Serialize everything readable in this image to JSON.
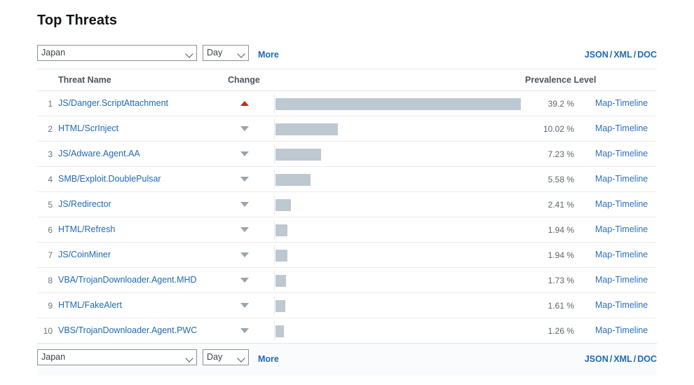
{
  "page": {
    "title": "Top Threats"
  },
  "controls": {
    "country_value": "Japan",
    "period_value": "Day",
    "more_label": "More",
    "export": {
      "json_label": "JSON",
      "xml_label": "XML",
      "doc_label": "DOC",
      "separator": "/"
    }
  },
  "table": {
    "headers": {
      "threat_name": "Threat Name",
      "change": "Change",
      "prevalence_level": "Prevalence Level"
    },
    "link_label": "Map-Timeline",
    "rows": [
      {
        "rank": "1",
        "name": "JS/Danger.ScriptAttachment",
        "change": "up",
        "percent": "39.2 %",
        "link": "Map-Timeline"
      },
      {
        "rank": "2",
        "name": "HTML/ScrInject",
        "change": "down",
        "percent": "10.02 %",
        "link": "Map-Timeline"
      },
      {
        "rank": "3",
        "name": "JS/Adware.Agent.AA",
        "change": "down",
        "percent": "7.23 %",
        "link": "Map-Timeline"
      },
      {
        "rank": "4",
        "name": "SMB/Exploit.DoublePulsar",
        "change": "down",
        "percent": "5.58 %",
        "link": "Map-Timeline"
      },
      {
        "rank": "5",
        "name": "JS/Redirector",
        "change": "down",
        "percent": "2.41 %",
        "link": "Map-Timeline"
      },
      {
        "rank": "6",
        "name": "HTML/Refresh",
        "change": "down",
        "percent": "1.94 %",
        "link": "Map-Timeline"
      },
      {
        "rank": "7",
        "name": "JS/CoinMiner",
        "change": "down",
        "percent": "1.94 %",
        "link": "Map-Timeline"
      },
      {
        "rank": "8",
        "name": "VBA/TrojanDownloader.Agent.MHD",
        "change": "down",
        "percent": "1.73 %",
        "link": "Map-Timeline"
      },
      {
        "rank": "9",
        "name": "HTML/FakeAlert",
        "change": "down",
        "percent": "1.61 %",
        "link": "Map-Timeline"
      },
      {
        "rank": "10",
        "name": "VBS/TrojanDownloader.Agent.PWC",
        "change": "down",
        "percent": "1.26 %",
        "link": "Map-Timeline"
      }
    ]
  },
  "chart_data": {
    "type": "bar",
    "title": "Top Threats",
    "xlabel": "Prevalence Level",
    "ylabel": "Threat Name",
    "orientation": "horizontal",
    "categories": [
      "JS/Danger.ScriptAttachment",
      "HTML/ScrInject",
      "JS/Adware.Agent.AA",
      "SMB/Exploit.DoublePulsar",
      "JS/Redirector",
      "HTML/Refresh",
      "JS/CoinMiner",
      "VBA/TrojanDownloader.Agent.MHD",
      "HTML/FakeAlert",
      "VBS/TrojanDownloader.Agent.PWC"
    ],
    "values": [
      39.2,
      10.02,
      7.23,
      5.58,
      2.41,
      1.94,
      1.94,
      1.73,
      1.61,
      1.26
    ],
    "unit": "%",
    "xlim": [
      0,
      39.2
    ],
    "grid": false,
    "legend": false,
    "bar_color": "#bdc8d1",
    "change_direction": [
      "up",
      "down",
      "down",
      "down",
      "down",
      "down",
      "down",
      "down",
      "down",
      "down"
    ]
  },
  "colors": {
    "link_blue": "#1f69b3",
    "row_link_blue": "#2c6fbb",
    "bar_gray": "#bdc8d1",
    "up_red": "#d32216",
    "down_gray": "#9aa3ab",
    "header_text": "#4a5662"
  }
}
